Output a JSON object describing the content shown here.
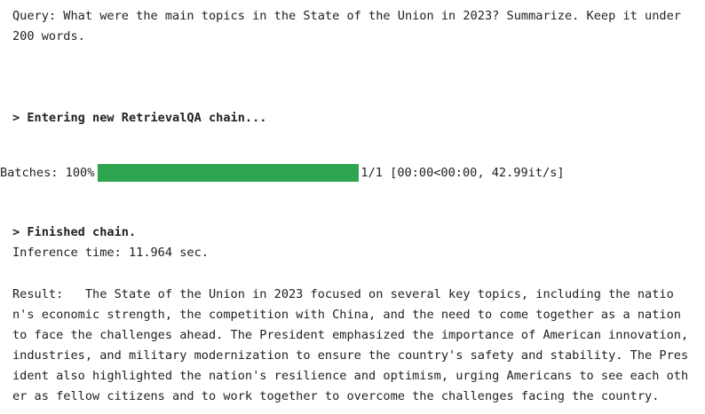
{
  "output": {
    "query_lines": [
      "Query: What were the main topics in the State of the Union in 2023? Summarize. Keep it under",
      "200 words."
    ],
    "entering_chain": "> Entering new RetrievalQA chain...",
    "progress": {
      "label": "Batches: 100%",
      "fraction": 1.0,
      "stats": "1/1 [00:00<00:00, 42.99it/s]",
      "color": "#2ea44f"
    },
    "finished_chain": "> Finished chain.",
    "inference_time": "Inference time: 11.964 sec.",
    "result_lines": [
      "Result:   The State of the Union in 2023 focused on several key topics, including the natio",
      "n's economic strength, the competition with China, and the need to come together as a nation",
      "to face the challenges ahead. The President emphasized the importance of American innovation,",
      "industries, and military modernization to ensure the country's safety and stability. The Pres",
      "ident also highlighted the nation's resilience and optimism, urging Americans to see each oth",
      "er as fellow citizens and to work together to overcome the challenges facing the country."
    ]
  }
}
